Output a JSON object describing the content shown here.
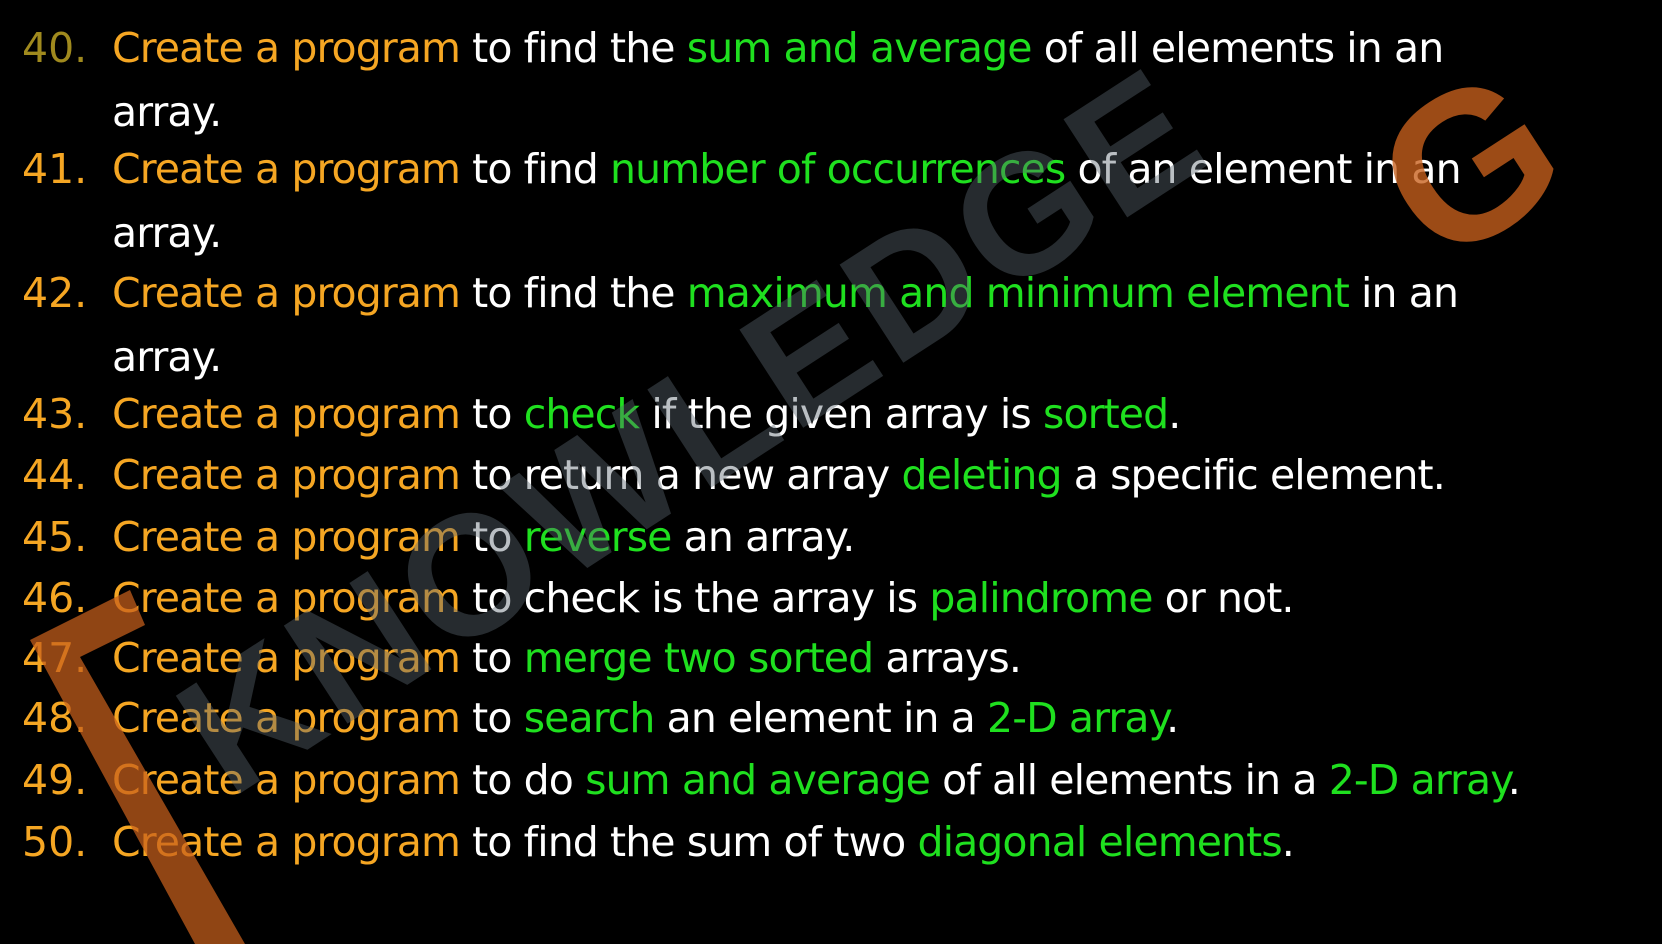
{
  "colors": {
    "background": "#000000",
    "orange": "#f5a623",
    "green": "#1fe01f",
    "white": "#ffffff",
    "watermark_gray": "#3a4148",
    "watermark_orange": "#c8601c"
  },
  "watermark": {
    "text": "KNOWLEDGE",
    "logo_letter": "G"
  },
  "items": [
    {
      "number": "40.",
      "segments": [
        {
          "t": "Create a program",
          "c": "o"
        },
        {
          "t": " to find the ",
          "c": "w"
        },
        {
          "t": "sum and average",
          "c": "g"
        },
        {
          "t": " of all elements in an",
          "c": "w"
        }
      ],
      "line2": "array."
    },
    {
      "number": "41.",
      "segments": [
        {
          "t": "Create a program",
          "c": "o"
        },
        {
          "t": " to find ",
          "c": "w"
        },
        {
          "t": "number of occurrences",
          "c": "g"
        },
        {
          "t": " of an element in an",
          "c": "w"
        }
      ],
      "line2": "array."
    },
    {
      "number": "42.",
      "segments": [
        {
          "t": "Create a program",
          "c": "o"
        },
        {
          "t": " to find the ",
          "c": "w"
        },
        {
          "t": "maximum and minimum element",
          "c": "g"
        },
        {
          "t": " in an",
          "c": "w"
        }
      ],
      "line2": "array."
    },
    {
      "number": "43.",
      "segments": [
        {
          "t": "Create a program",
          "c": "o"
        },
        {
          "t": " to ",
          "c": "w"
        },
        {
          "t": "check",
          "c": "g"
        },
        {
          "t": " if the given array is ",
          "c": "w"
        },
        {
          "t": "sorted",
          "c": "g"
        },
        {
          "t": ".",
          "c": "w"
        }
      ]
    },
    {
      "number": "44.",
      "segments": [
        {
          "t": "Create a program",
          "c": "o"
        },
        {
          "t": " to return a new array ",
          "c": "w"
        },
        {
          "t": "deleting",
          "c": "g"
        },
        {
          "t": " a specific element.",
          "c": "w"
        }
      ]
    },
    {
      "number": "45.",
      "segments": [
        {
          "t": "Create a program",
          "c": "o"
        },
        {
          "t": " to ",
          "c": "w"
        },
        {
          "t": "reverse",
          "c": "g"
        },
        {
          "t": " an array.",
          "c": "w"
        }
      ]
    },
    {
      "number": "46.",
      "segments": [
        {
          "t": "Create a program",
          "c": "o"
        },
        {
          "t": " to check is the array is ",
          "c": "w"
        },
        {
          "t": "palindrome",
          "c": "g"
        },
        {
          "t": " or not.",
          "c": "w"
        }
      ]
    },
    {
      "number": "47.",
      "segments": [
        {
          "t": "Create a program",
          "c": "o"
        },
        {
          "t": " to ",
          "c": "w"
        },
        {
          "t": "merge two sorted",
          "c": "g"
        },
        {
          "t": " arrays.",
          "c": "w"
        }
      ]
    },
    {
      "number": "48.",
      "segments": [
        {
          "t": "Create a program",
          "c": "o"
        },
        {
          "t": " to ",
          "c": "w"
        },
        {
          "t": "search",
          "c": "g"
        },
        {
          "t": " an element in a ",
          "c": "w"
        },
        {
          "t": "2-D array",
          "c": "g"
        },
        {
          "t": ".",
          "c": "w"
        }
      ]
    },
    {
      "number": "49.",
      "segments": [
        {
          "t": "Create a program",
          "c": "o"
        },
        {
          "t": " to do ",
          "c": "w"
        },
        {
          "t": "sum and average",
          "c": "g"
        },
        {
          "t": " of all elements in a ",
          "c": "w"
        },
        {
          "t": "2-D array",
          "c": "g"
        },
        {
          "t": ".",
          "c": "w"
        }
      ]
    },
    {
      "number": "50.",
      "segments": [
        {
          "t": "Create a program",
          "c": "o"
        },
        {
          "t": " to find the sum of two ",
          "c": "w"
        },
        {
          "t": "diagonal elements",
          "c": "g"
        },
        {
          "t": ".",
          "c": "w"
        }
      ]
    }
  ]
}
